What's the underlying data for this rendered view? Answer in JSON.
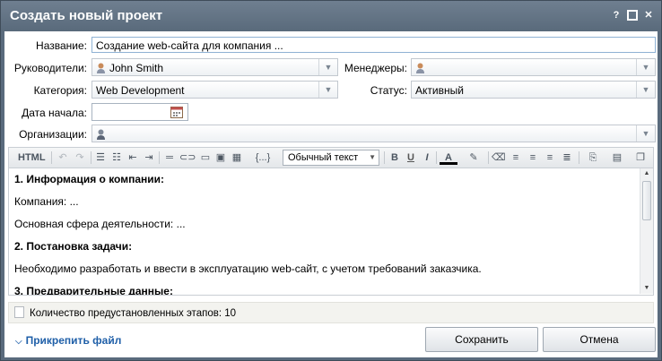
{
  "window": {
    "title": "Создать новый проект",
    "help_label": "?",
    "close_label": "✕"
  },
  "form": {
    "name": {
      "label": "Название:",
      "value": "Создание web-сайта для компания ..."
    },
    "leaders": {
      "label": "Руководители:",
      "value": "John Smith"
    },
    "managers": {
      "label": "Менеджеры:",
      "value": ""
    },
    "category": {
      "label": "Категория:",
      "value": "Web Development"
    },
    "status": {
      "label": "Статус:",
      "value": "Активный"
    },
    "start_date": {
      "label": "Дата начала:",
      "value": ""
    },
    "organizations": {
      "label": "Организации:",
      "value": ""
    }
  },
  "toolbar": {
    "html_label": "HTML",
    "style_value": "Обычный текст",
    "bold_label": "B",
    "italic_label": "I",
    "underline_label": "U",
    "special_label": "{...}"
  },
  "editor": {
    "paragraphs": [
      {
        "text": "1. Информация о компании:",
        "bold": true
      },
      {
        "text": "Компания: ...",
        "bold": false
      },
      {
        "text": "Основная сфера деятельности: ...",
        "bold": false
      },
      {
        "text": "2. Постановка задачи:",
        "bold": true
      },
      {
        "text": "Необходимо разработать и ввести в эксплуатацию web-сайт, с учетом требований заказчика.",
        "bold": false
      },
      {
        "text": "3. Предварительные данные:",
        "bold": true
      }
    ]
  },
  "stages": {
    "text": "Количество предустановленных этапов: 10"
  },
  "footer": {
    "attach_label": "Прикрепить файл",
    "save_label": "Сохранить",
    "cancel_label": "Отмена"
  },
  "colors": {
    "titlebar": "#5f7082",
    "link": "#1f5fa8",
    "panel": "#f3f3ef"
  }
}
